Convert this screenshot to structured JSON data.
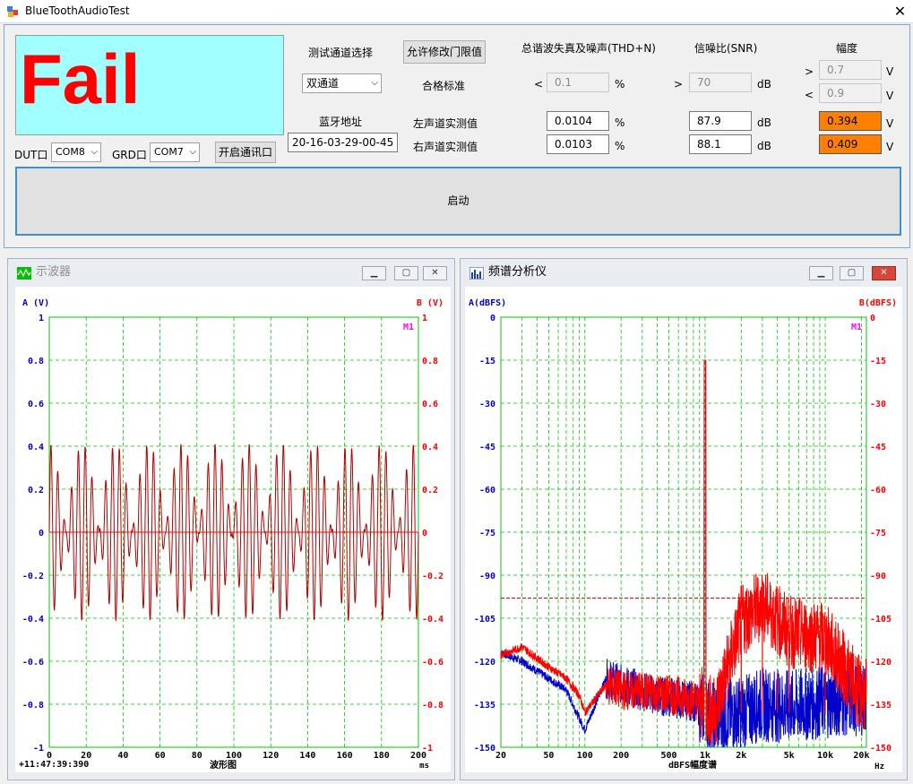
{
  "window": {
    "title": "BlueToothAudioTest",
    "close": "✕"
  },
  "status": {
    "result": "Fail"
  },
  "ports": {
    "dut_label": "DUT口",
    "dut_value": "COM8",
    "grd_label": "GRD口",
    "grd_value": "COM7",
    "open_button": "开启通讯口"
  },
  "channel": {
    "label": "测试通道选择",
    "value": "双通道"
  },
  "bt": {
    "label": "蓝牙地址",
    "value": "20-16-03-29-00-45"
  },
  "limits": {
    "allow_button": "允许修改门限值",
    "standard_label": "合格标准",
    "thd_header": "总谐波失真及噪声(THD+N)",
    "snr_header": "信噪比(SNR)",
    "amp_header": "幅度",
    "thd_op": "<",
    "thd_limit": "0.1",
    "thd_unit": "%",
    "snr_op": ">",
    "snr_limit": "70",
    "snr_unit": "dB",
    "amp_op_hi": ">",
    "amp_hi": "0.7",
    "amp_op_lo": "<",
    "amp_lo": "0.9",
    "amp_unit": "V"
  },
  "left": {
    "label": "左声道实测值",
    "thd": "0.0104",
    "thd_unit": "%",
    "snr": "87.9",
    "snr_unit": "dB",
    "amp": "0.394",
    "amp_unit": "V"
  },
  "right": {
    "label": "右声道实测值",
    "thd": "0.0103",
    "thd_unit": "%",
    "snr": "88.1",
    "snr_unit": "dB",
    "amp": "0.409",
    "amp_unit": "V"
  },
  "start_button": "启动",
  "colors": {
    "chan_a": "#0000cc",
    "chan_b": "#ff0000",
    "grid": "#00c800",
    "wave": "#b00000",
    "pink": "#ff00ff",
    "fail_bg": "#a2ffff"
  },
  "oscilloscope": {
    "title": "示波器",
    "axis_a": "A (V)",
    "axis_b": "B (V)",
    "m_marker": "M1",
    "y_ticks": [
      "1",
      "0.8",
      "0.6",
      "0.4",
      "0.2",
      "0",
      "-0.2",
      "-0.4",
      "-0.6",
      "-0.8",
      "-1"
    ],
    "x_ticks": [
      "0",
      "20",
      "40",
      "60",
      "80",
      "100",
      "120",
      "140",
      "160",
      "180",
      "200"
    ],
    "xlabel": "波形图",
    "xunit": "ms",
    "timestamp": "+11:47:39:390",
    "buttons": {
      "min": "▁",
      "max": "▢",
      "close": "✕"
    }
  },
  "spectrum": {
    "title": "频谱分析仪",
    "axis_a": "A(dBFS)",
    "axis_b": "B(dBFS)",
    "m_marker": "M1",
    "y_ticks": [
      "0",
      "-15",
      "-30",
      "-45",
      "-60",
      "-75",
      "-90",
      "-105",
      "-120",
      "-135",
      "-150"
    ],
    "y_ticks_right": [
      "0",
      "-15",
      "-30",
      "-45",
      "-60",
      "-75",
      "-90",
      "-105",
      "-120",
      "-135",
      "-150"
    ],
    "x_ticks": [
      "20",
      "50",
      "100",
      "200",
      "500",
      "1k",
      "2k",
      "5k",
      "10k",
      "20k"
    ],
    "xlabel": "dBFS幅度谱",
    "xunit": "Hz",
    "buttons": {
      "min": "▁",
      "max": "▢",
      "close": "✕"
    }
  },
  "chart_data": [
    {
      "type": "line",
      "title": "",
      "xlabel": "波形图",
      "ylabel": "A (V)",
      "ylabel_right": "B (V)",
      "xlim": [
        0,
        200
      ],
      "ylim": [
        -1,
        1
      ],
      "grid": true,
      "series": [
        {
          "name": "",
          "carrier_hz": 1000,
          "envelope_period_ms": 18,
          "peak_amplitude": 0.41,
          "x": [
            0,
            9,
            18,
            27,
            36,
            45
          ],
          "y": [
            0.41,
            0.02,
            0.41,
            0.02,
            0.41,
            0.02
          ]
        }
      ]
    },
    {
      "type": "line",
      "title": "",
      "xlabel": "dBFS幅度谱",
      "ylabel": "A(dBFS)",
      "ylabel_right": "B(dBFS)",
      "xscale": "log",
      "xlim": [
        20,
        22000
      ],
      "ylim": [
        -150,
        0
      ],
      "grid": true,
      "reference_line_db": -98,
      "series": [
        {
          "name": "",
          "x": [
            20,
            30,
            50,
            70,
            90,
            100,
            150,
            200,
            400,
            800,
            1000,
            1200,
            2000,
            3000,
            5000,
            10000,
            20000
          ],
          "y": [
            -117,
            -120,
            -126,
            -130,
            -140,
            -144,
            -126,
            -128,
            -132,
            -134,
            -15,
            -140,
            -138,
            -135,
            -136,
            -134,
            -133
          ]
        },
        {
          "name": "",
          "x": [
            20,
            30,
            50,
            70,
            90,
            100,
            150,
            200,
            400,
            800,
            1000,
            1200,
            2000,
            3000,
            5000,
            10000,
            20000
          ],
          "y": [
            -118,
            -115,
            -122,
            -126,
            -132,
            -138,
            -128,
            -130,
            -131,
            -133,
            -15,
            -138,
            -106,
            -100,
            -110,
            -112,
            -132
          ]
        }
      ]
    }
  ]
}
